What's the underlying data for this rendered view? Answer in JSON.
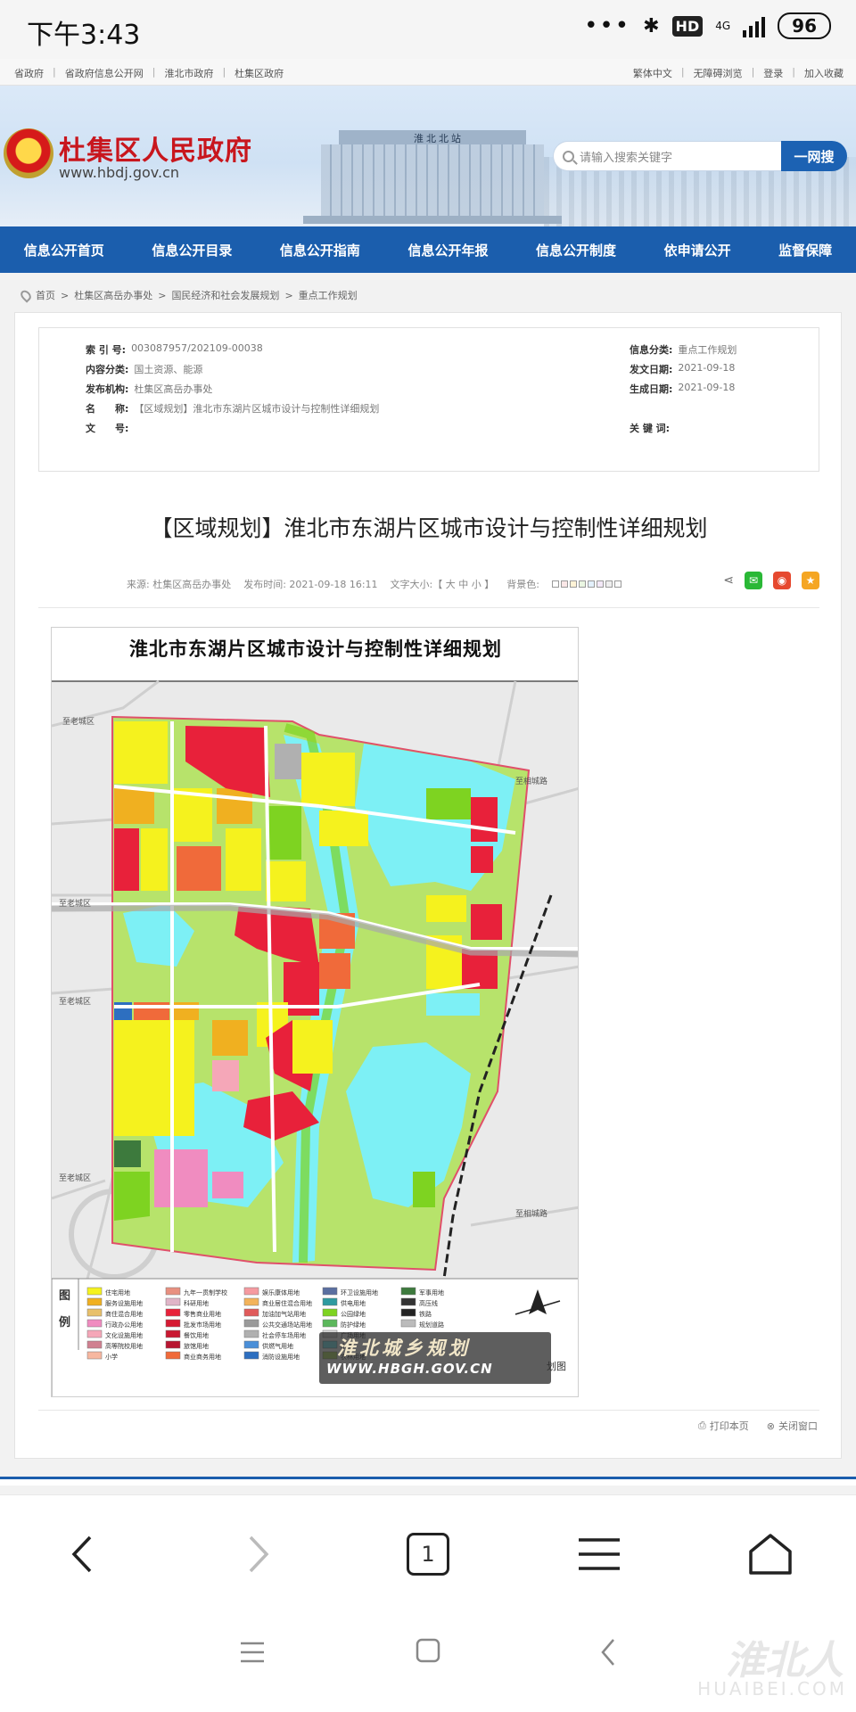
{
  "status_bar": {
    "time": "下午3:43",
    "hd": "HD",
    "network": "4G",
    "battery": "96"
  },
  "top_links": {
    "left": [
      "省政府",
      "省政府信息公开网",
      "淮北市政府",
      "杜集区政府"
    ],
    "right": [
      "繁体中文",
      "无障碍浏览",
      "登录",
      "加入收藏"
    ]
  },
  "header": {
    "site_title": "杜集区人民政府",
    "site_url": "www.hbdj.gov.cn",
    "building_sign": "淮北北站",
    "search_placeholder": "请输入搜索关键字",
    "search_button": "一网搜"
  },
  "nav": [
    "信息公开首页",
    "信息公开目录",
    "信息公开指南",
    "信息公开年报",
    "信息公开制度",
    "依申请公开",
    "监督保障"
  ],
  "breadcrumb": [
    "首页",
    "杜集区高岳办事处",
    "国民经济和社会发展规划",
    "重点工作规划"
  ],
  "meta": {
    "index_label": "索 引 号:",
    "index_value": "003087957/202109-00038",
    "category_label": "内容分类:",
    "category_value": "国土资源、能源",
    "publisher_label": "发布机构:",
    "publisher_value": "杜集区高岳办事处",
    "name_label": "名　　称:",
    "name_value": "【区域规划】淮北市东湖片区城市设计与控制性详细规划",
    "docno_label": "文　　号:",
    "docno_value": "",
    "info_class_label": "信息分类:",
    "info_class_value": "重点工作规划",
    "issue_date_label": "发文日期:",
    "issue_date_value": "2021-09-18",
    "gen_date_label": "生成日期:",
    "gen_date_value": "2021-09-18",
    "keywords_label": "关 键 词:",
    "keywords_value": ""
  },
  "article": {
    "title": "【区域规划】淮北市东湖片区城市设计与控制性详细规划",
    "source": "来源: 杜集区高岳办事处",
    "publish_time": "发布时间: 2021-09-18 16:11",
    "font_size": "文字大小:【 大 中 小 】",
    "bg_color": "背景色:",
    "swatch_colors": [
      "#ffffff",
      "#fbe7e7",
      "#fff3d6",
      "#eaf6e2",
      "#e3f0fb",
      "#f3e8f7",
      "#eeeeee",
      "#fafafa"
    ]
  },
  "map": {
    "title": "淮北市东湖片区城市设计与控制性详细规划",
    "legend_heading_1": "图",
    "legend_heading_2": "例",
    "road_labels": [
      "至老城区",
      "至老城区",
      "至老城区",
      "至老城区",
      "至相城路",
      "至相城路"
    ],
    "watermark_line1": "淮北城乡规划",
    "watermark_line2": "WWW.HBGH.GOV.CN",
    "tail": "划图",
    "legend": [
      {
        "label": "住宅用地",
        "color": "#f5f21e"
      },
      {
        "label": "服务设施用地",
        "color": "#f0b020"
      },
      {
        "label": "商住混合用地",
        "color": "#e8c06a"
      },
      {
        "label": "行政办公用地",
        "color": "#f08cc0"
      },
      {
        "label": "文化设施用地",
        "color": "#f5a7b8"
      },
      {
        "label": "高等院校用地",
        "color": "#d08090"
      },
      {
        "label": "小学",
        "color": "#f7b7a0"
      },
      {
        "label": "九年一贯制学校",
        "color": "#e89080"
      },
      {
        "label": "科研用地",
        "color": "#e0b5c8"
      },
      {
        "label": "零售商业用地",
        "color": "#e8213a"
      },
      {
        "label": "批发市场用地",
        "color": "#d61a33"
      },
      {
        "label": "餐饮用地",
        "color": "#c91831"
      },
      {
        "label": "旅馆用地",
        "color": "#b81530"
      },
      {
        "label": "商业商务用地",
        "color": "#f06a3a"
      },
      {
        "label": "娱乐康体用地",
        "color": "#f59aa0"
      },
      {
        "label": "商业居住混合用地",
        "color": "#f3b35a"
      },
      {
        "label": "加油加气站用地",
        "color": "#e05a5a"
      },
      {
        "label": "公共交通场站用地",
        "color": "#9a9a9a"
      },
      {
        "label": "社会停车场用地",
        "color": "#b0b0b0"
      },
      {
        "label": "供燃气用地",
        "color": "#4a8fd8"
      },
      {
        "label": "消防设施用地",
        "color": "#2d6fc0"
      },
      {
        "label": "环卫设施用地",
        "color": "#5a6fa0"
      },
      {
        "label": "供电用地",
        "color": "#2e9aa0"
      },
      {
        "label": "公园绿地",
        "color": "#7ed321"
      },
      {
        "label": "防护绿地",
        "color": "#5cb85c"
      },
      {
        "label": "广场用地",
        "color": "#d9d9d9"
      },
      {
        "label": "水域",
        "color": "#7df0f5"
      },
      {
        "label": "农林用地",
        "color": "#b7e36b"
      },
      {
        "label": "军事用地",
        "color": "#3d7a3d"
      },
      {
        "label": "高压线",
        "color": "#333333"
      },
      {
        "label": "铁路",
        "color": "#222222"
      },
      {
        "label": "规划道路",
        "color": "#bbbbbb"
      }
    ]
  },
  "footer_actions": {
    "print": "打印本页",
    "close": "关闭窗口"
  },
  "browser": {
    "tab_count": "1"
  },
  "corner_watermark": {
    "line1": "淮北人",
    "line2": "HUAIBEI.COM"
  }
}
